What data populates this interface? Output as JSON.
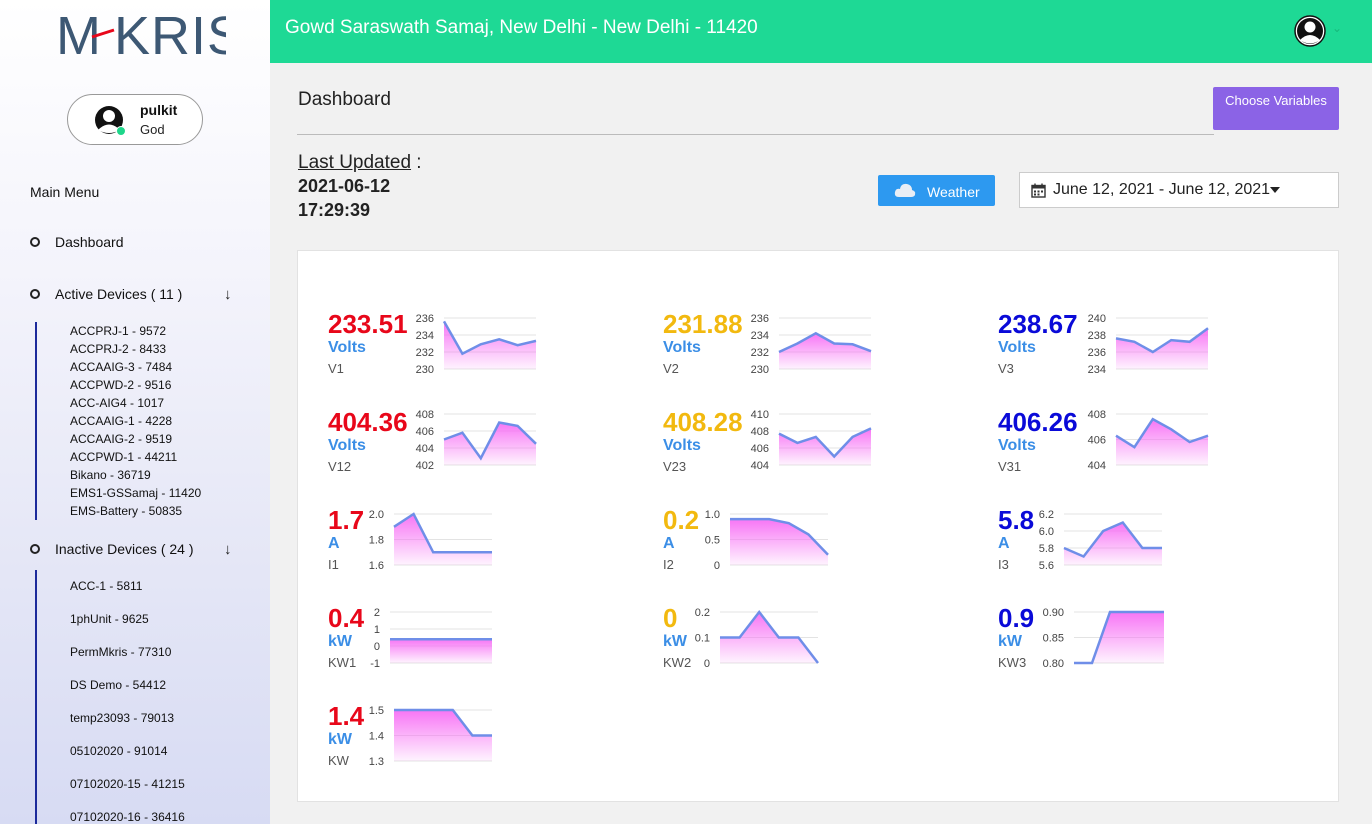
{
  "brand": {
    "logo_text": "M-KRIS"
  },
  "user": {
    "name": "pulkit",
    "role": "God"
  },
  "header": {
    "title": "Gowd Saraswath Samaj, New Delhi - New Delhi - 11420"
  },
  "menu": {
    "title": "Main Menu",
    "dashboard": "Dashboard",
    "active_devices": "Active Devices ( 11 )",
    "inactive_devices": "Inactive Devices ( 24 )",
    "active_list": [
      "ACCPRJ-1 - 9572",
      "ACCPRJ-2 - 8433",
      "ACCAAIG-3 - 7484",
      "ACCPWD-2 - 9516",
      "ACC-AIG4 - 1017",
      "ACCAAIG-1 - 4228",
      "ACCAAIG-2 - 9519",
      "ACCPWD-1 - 44211",
      "Bikano - 36719",
      "EMS1-GSSamaj - 11420",
      "EMS-Battery - 50835"
    ],
    "inactive_list": [
      "ACC-1 - 5811",
      "1phUnit - 9625",
      "PermMkris - 77310",
      "DS Demo - 54412",
      "temp23093 - 79013",
      "05102020 - 91014",
      "07102020-15 - 41215",
      "07102020-16 - 36416"
    ]
  },
  "page": {
    "title": "Dashboard",
    "choose_variables": "Choose Variables",
    "last_updated_label": "Last Updated",
    "last_updated_sep": " :",
    "last_updated_date": "2021-06-12",
    "last_updated_time": "17:29:39",
    "weather": "Weather",
    "date_range": "June 12, 2021 - June 12, 2021"
  },
  "colors": {
    "red": "#e8071a",
    "yellow": "#f2b90f",
    "blue": "#0a0ad8",
    "line": "#6f8ee8",
    "fill_top": "#f76ef5",
    "header": "#1ed995",
    "button": "#8b63e6"
  },
  "metrics": [
    {
      "value": "233.51",
      "unit": "Volts",
      "label": "V1",
      "color": "red",
      "ticks": [
        "236",
        "234",
        "232",
        "230"
      ],
      "ymin": 230,
      "ymax": 236,
      "series": [
        235.6,
        231.8,
        232.9,
        233.5,
        232.8,
        233.3
      ]
    },
    {
      "value": "231.88",
      "unit": "Volts",
      "label": "V2",
      "color": "yellow",
      "ticks": [
        "236",
        "234",
        "232",
        "230"
      ],
      "ymin": 230,
      "ymax": 236,
      "series": [
        232.0,
        233.0,
        234.2,
        233.0,
        232.9,
        232.1
      ]
    },
    {
      "value": "238.67",
      "unit": "Volts",
      "label": "V3",
      "color": "blue",
      "ticks": [
        "240",
        "238",
        "236",
        "234"
      ],
      "ymin": 234,
      "ymax": 240,
      "series": [
        237.6,
        237.2,
        236.0,
        237.4,
        237.2,
        238.8
      ]
    },
    {
      "value": "404.36",
      "unit": "Volts",
      "label": "V12",
      "color": "red",
      "ticks": [
        "408",
        "406",
        "404",
        "402"
      ],
      "ymin": 402,
      "ymax": 408,
      "series": [
        405.0,
        405.8,
        402.8,
        407.0,
        406.6,
        404.5
      ]
    },
    {
      "value": "408.28",
      "unit": "Volts",
      "label": "V23",
      "color": "yellow",
      "ticks": [
        "410",
        "408",
        "406",
        "404"
      ],
      "ymin": 404,
      "ymax": 410,
      "series": [
        407.7,
        406.6,
        407.3,
        405.0,
        407.3,
        408.3
      ]
    },
    {
      "value": "406.26",
      "unit": "Volts",
      "label": "V31",
      "color": "blue",
      "ticks": [
        "408",
        "406",
        "404"
      ],
      "ymin": 404,
      "ymax": 408,
      "series": [
        406.3,
        405.4,
        407.6,
        406.8,
        405.8,
        406.3
      ]
    },
    {
      "value": "1.7",
      "unit": "A",
      "label": "I1",
      "color": "red",
      "ticks": [
        "2.0",
        "1.8",
        "1.6"
      ],
      "ymin": 1.6,
      "ymax": 2.0,
      "series": [
        1.9,
        2.0,
        1.7,
        1.7,
        1.7,
        1.7
      ]
    },
    {
      "value": "0.2",
      "unit": "A",
      "label": "I2",
      "color": "yellow",
      "ticks": [
        "1.0",
        "0.5",
        "0"
      ],
      "ymin": 0,
      "ymax": 1.0,
      "series": [
        0.9,
        0.9,
        0.9,
        0.82,
        0.6,
        0.2
      ]
    },
    {
      "value": "5.8",
      "unit": "A",
      "label": "I3",
      "color": "blue",
      "ticks": [
        "6.2",
        "6.0",
        "5.8",
        "5.6"
      ],
      "ymin": 5.6,
      "ymax": 6.2,
      "series": [
        5.8,
        5.7,
        6.0,
        6.1,
        5.8,
        5.8
      ]
    },
    {
      "value": "0.4",
      "unit": "kW",
      "label": "KW1",
      "color": "red",
      "ticks": [
        "2",
        "1",
        "0",
        "-1"
      ],
      "ymin": -1,
      "ymax": 2,
      "series": [
        0.4,
        0.4,
        0.4,
        0.4,
        0.4,
        0.4
      ]
    },
    {
      "value": "0",
      "unit": "kW",
      "label": "KW2",
      "color": "yellow",
      "ticks": [
        "0.2",
        "0.1",
        "0"
      ],
      "ymin": 0,
      "ymax": 0.2,
      "series": [
        0.1,
        0.1,
        0.2,
        0.1,
        0.1,
        0.0
      ]
    },
    {
      "value": "0.9",
      "unit": "kW",
      "label": "KW3",
      "color": "blue",
      "ticks": [
        "0.90",
        "0.85",
        "0.80"
      ],
      "ymin": 0.8,
      "ymax": 0.9,
      "series": [
        0.8,
        0.8,
        0.9,
        0.9,
        0.9,
        0.9
      ]
    },
    {
      "value": "1.4",
      "unit": "kW",
      "label": "KW",
      "color": "red",
      "ticks": [
        "1.5",
        "1.4",
        "1.3"
      ],
      "ymin": 1.3,
      "ymax": 1.5,
      "series": [
        1.5,
        1.5,
        1.5,
        1.5,
        1.4,
        1.4
      ]
    }
  ]
}
